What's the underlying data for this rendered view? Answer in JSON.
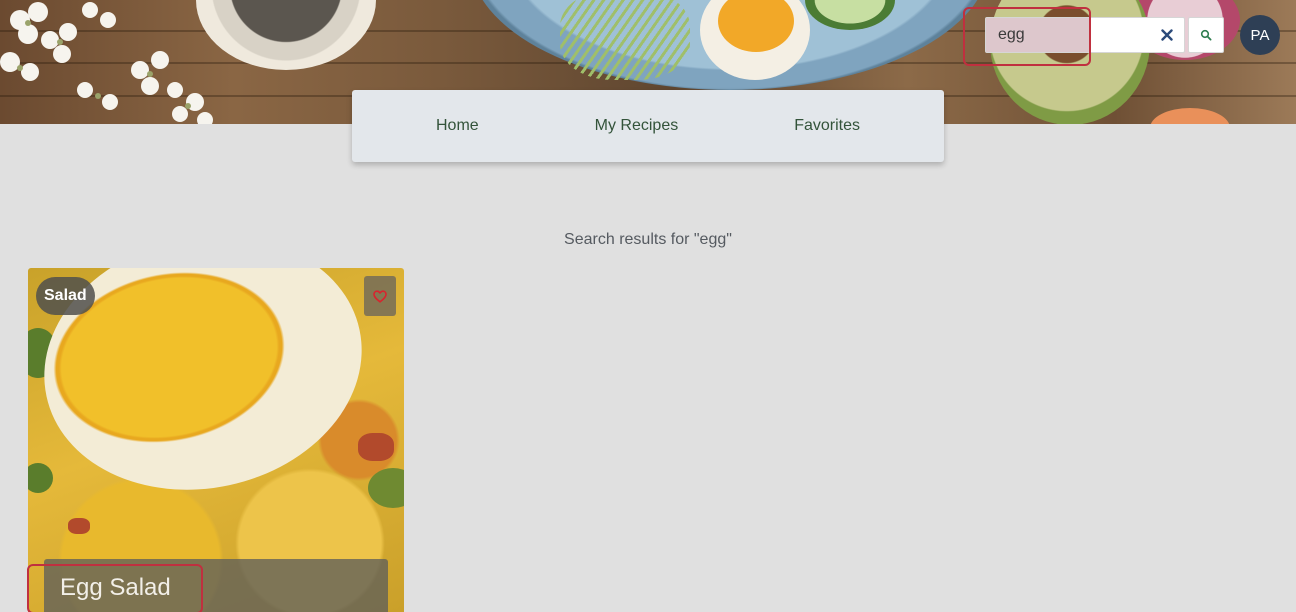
{
  "search": {
    "value": "egg",
    "clear_icon": "close-icon",
    "submit_icon": "search-icon"
  },
  "user": {
    "initials": "PA"
  },
  "nav": {
    "items": [
      {
        "label": "Home"
      },
      {
        "label": "My Recipes"
      },
      {
        "label": "Favorites"
      }
    ]
  },
  "results": {
    "heading": "Search results for \"egg\"",
    "cards": [
      {
        "title": "Egg Salad",
        "category": "Salad",
        "favorite_icon": "heart-outline-icon"
      }
    ]
  },
  "colors": {
    "highlight": "#c0303f",
    "nav_text": "#33533a",
    "avatar_bg": "#2e3f55",
    "page_bg": "#e0e0e0",
    "clear_icon": "#2a4a7a",
    "search_icon": "#2e7d4f",
    "heart": "#d8242e"
  }
}
